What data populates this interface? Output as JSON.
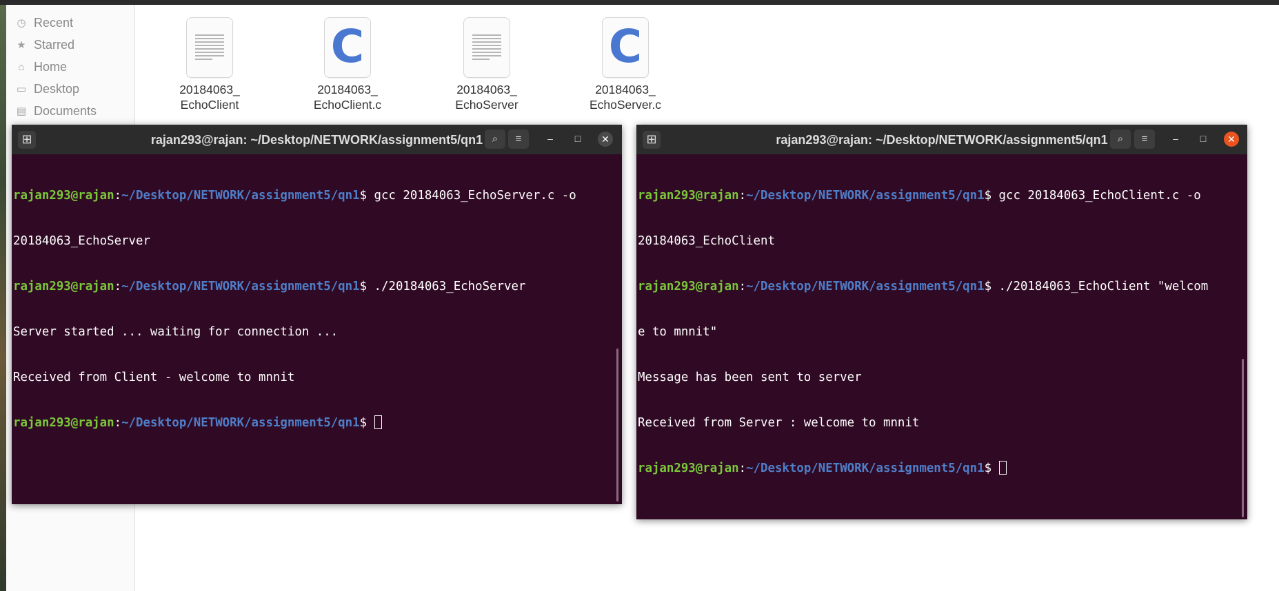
{
  "file_manager": {
    "sidebar": [
      {
        "label": "Recent",
        "icon": "clock-icon"
      },
      {
        "label": "Starred",
        "icon": "star-icon"
      },
      {
        "label": "Home",
        "icon": "home-icon"
      },
      {
        "label": "Desktop",
        "icon": "desktop-icon"
      },
      {
        "label": "Documents",
        "icon": "documents-icon"
      }
    ],
    "files": [
      {
        "line1": "20184063_",
        "line2": "EchoClient",
        "type": "binary"
      },
      {
        "line1": "20184063_",
        "line2": "EchoClient.c",
        "type": "c-source"
      },
      {
        "line1": "20184063_",
        "line2": "EchoServer",
        "type": "binary"
      },
      {
        "line1": "20184063_",
        "line2": "EchoServer.c",
        "type": "c-source"
      }
    ]
  },
  "terminal_left": {
    "title": "rajan293@rajan: ~/Desktop/NETWORK/assignment5/qn1",
    "lines": [
      {
        "user": "rajan293@rajan",
        "path": "~/Desktop/NETWORK/assignment5/qn1",
        "cmd": "$ gcc 20184063_EchoServer.c -o"
      },
      {
        "text": "20184063_EchoServer"
      },
      {
        "user": "rajan293@rajan",
        "path": "~/Desktop/NETWORK/assignment5/qn1",
        "cmd": "$ ./20184063_EchoServer"
      },
      {
        "text": "Server started ... waiting for connection ..."
      },
      {
        "text": "Received from Client - welcome to mnnit"
      },
      {
        "user": "rajan293@rajan",
        "path": "~/Desktop/NETWORK/assignment5/qn1",
        "cmd": "$ "
      }
    ]
  },
  "terminal_right": {
    "title": "rajan293@rajan: ~/Desktop/NETWORK/assignment5/qn1",
    "lines": [
      {
        "user": "rajan293@rajan",
        "path": "~/Desktop/NETWORK/assignment5/qn1",
        "cmd": "$ gcc 20184063_EchoClient.c -o"
      },
      {
        "text": "20184063_EchoClient"
      },
      {
        "user": "rajan293@rajan",
        "path": "~/Desktop/NETWORK/assignment5/qn1",
        "cmd": "$ ./20184063_EchoClient \"welcom"
      },
      {
        "text": "e to mnnit\""
      },
      {
        "text": "Message has been sent to server"
      },
      {
        "text": "Received from Server : welcome to mnnit"
      },
      {
        "user": "rajan293@rajan",
        "path": "~/Desktop/NETWORK/assignment5/qn1",
        "cmd": "$ "
      }
    ]
  },
  "colors": {
    "terminal_bg": "#300a24",
    "prompt_user": "#7bc73a",
    "prompt_path": "#4f7ec9",
    "close_active": "#e95420",
    "close_inactive": "#4a4a4a"
  }
}
